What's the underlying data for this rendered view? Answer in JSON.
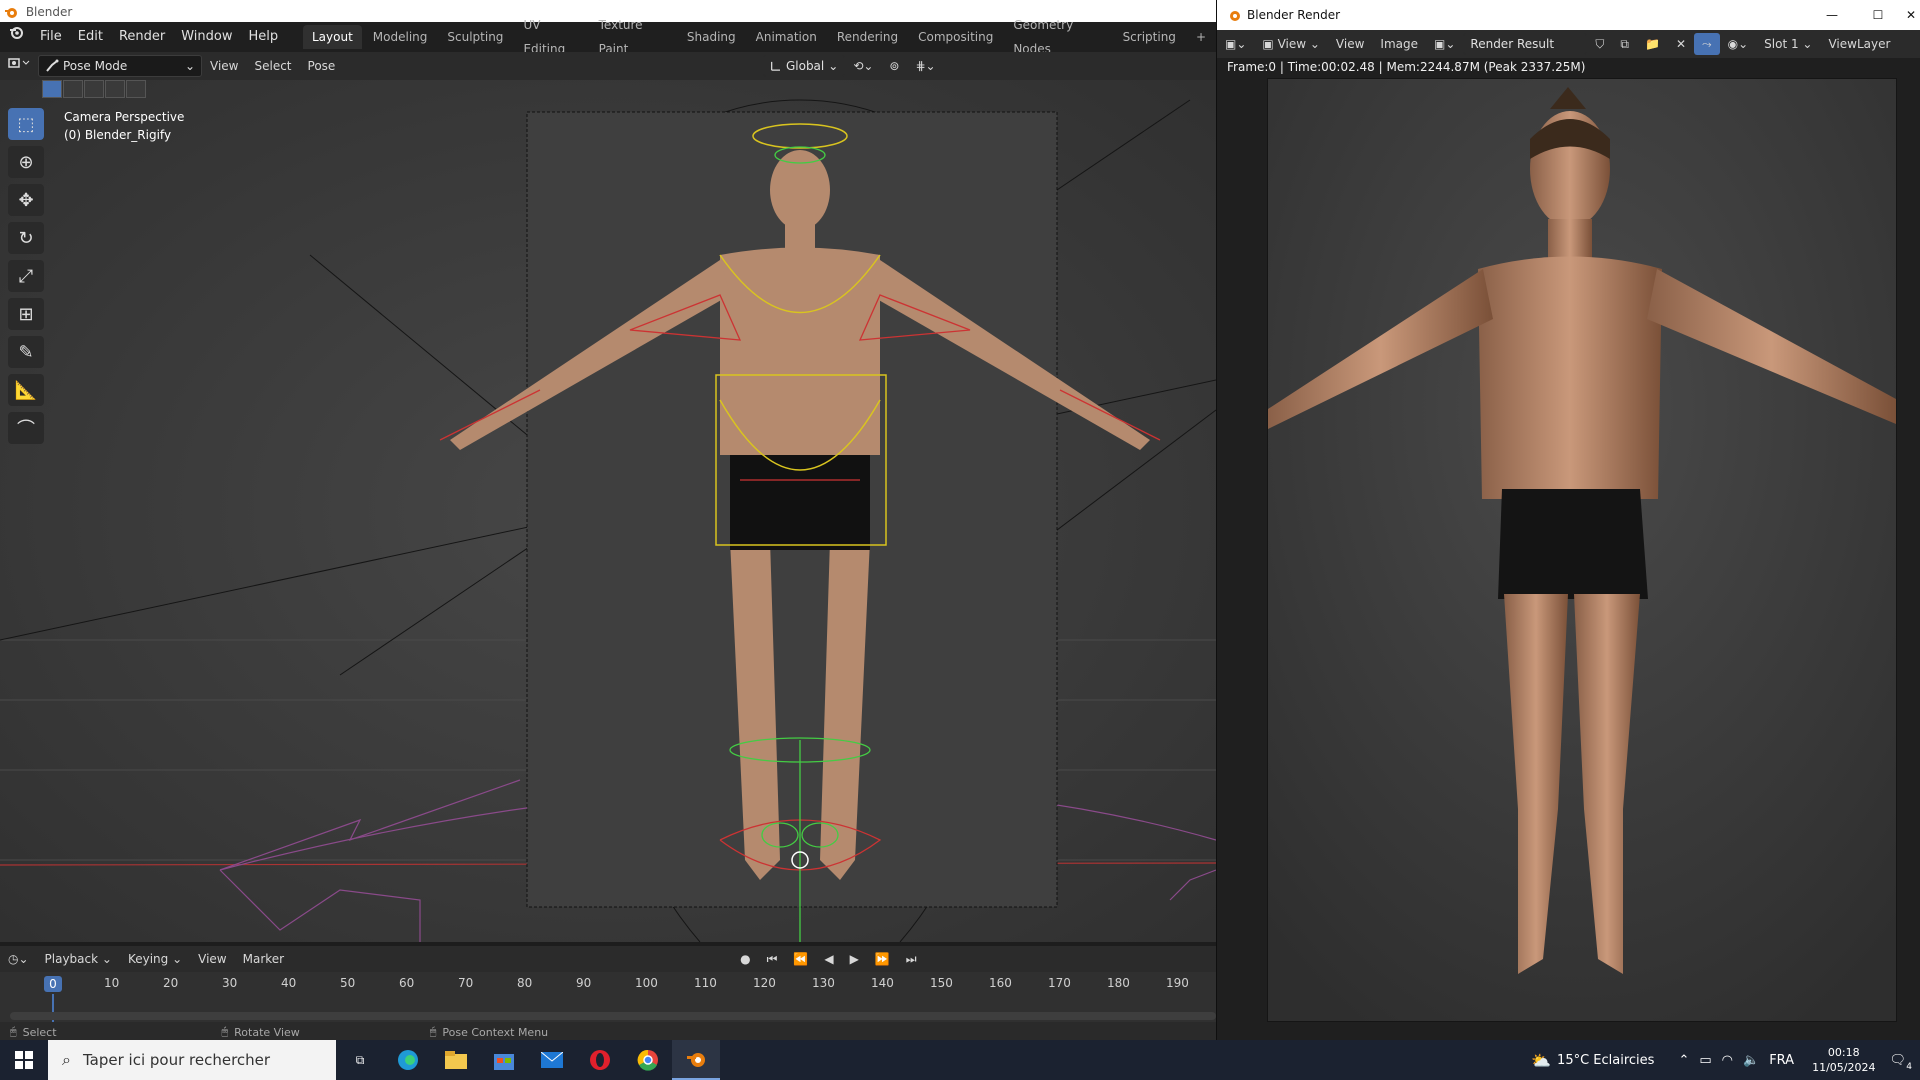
{
  "window": {
    "title": "Blender"
  },
  "menu": [
    "File",
    "Edit",
    "Render",
    "Window",
    "Help"
  ],
  "workspaces": [
    "Layout",
    "Modeling",
    "Sculpting",
    "UV Editing",
    "Texture Paint",
    "Shading",
    "Animation",
    "Rendering",
    "Compositing",
    "Geometry Nodes",
    "Scripting"
  ],
  "active_workspace": "Layout",
  "add_tab": "+",
  "header": {
    "mode": "Pose Mode",
    "view": "View",
    "select": "Select",
    "pose": "Pose",
    "transform_orientation": "Global"
  },
  "viewport": {
    "line1": "Camera Perspective",
    "line2": "(0) Blender_Rigify"
  },
  "timeline": {
    "playback": "Playback",
    "keying": "Keying",
    "view": "View",
    "marker": "Marker",
    "current_frame": "0",
    "ticks": [
      "10",
      "20",
      "30",
      "40",
      "50",
      "60",
      "70",
      "80",
      "90",
      "100",
      "110",
      "120",
      "130",
      "140",
      "150",
      "160",
      "170",
      "180",
      "190"
    ]
  },
  "status": {
    "select": "Select",
    "rotate": "Rotate View",
    "context": "Pose Context Menu"
  },
  "render": {
    "title": "Blender Render",
    "view_menu": "View",
    "view": "View",
    "image": "Image",
    "result": "Render Result",
    "slot": "Slot 1",
    "layer": "ViewLayer",
    "info": "Frame:0 | Time:00:02.48 | Mem:2244.87M (Peak 2337.25M)"
  },
  "taskbar": {
    "search_placeholder": "Taper ici pour rechercher",
    "weather": "15°C  Eclaircies",
    "lang": "FRA",
    "time": "00:18",
    "date": "11/05/2024",
    "notifications": "4"
  },
  "colors": {
    "accent": "#4772b3",
    "blender_orange": "#e87d0d"
  }
}
